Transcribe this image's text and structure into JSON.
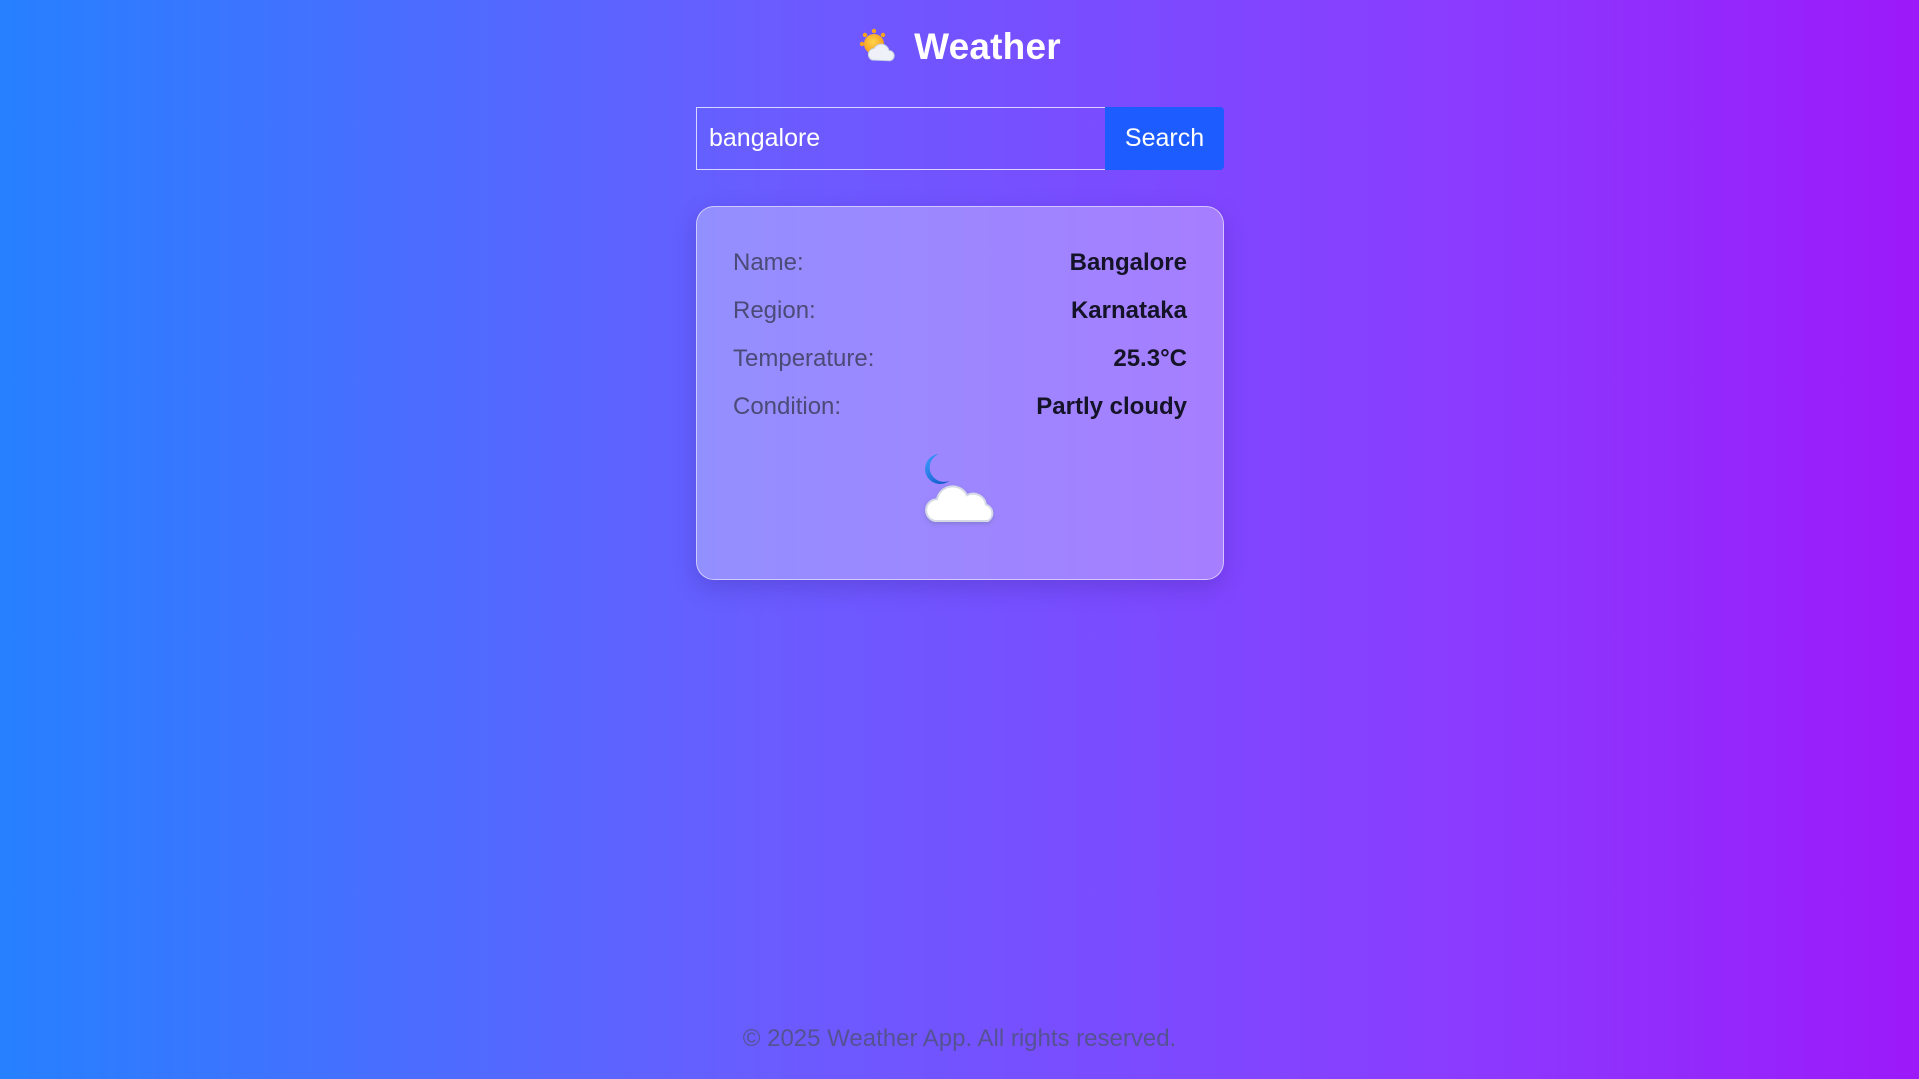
{
  "header": {
    "title": "Weather",
    "icon": "sun-behind-cloud-icon"
  },
  "search": {
    "value": "bangalore",
    "button_label": "Search"
  },
  "weather": {
    "rows": [
      {
        "label": "Name:",
        "value": "Bangalore"
      },
      {
        "label": "Region:",
        "value": "Karnataka"
      },
      {
        "label": "Temperature:",
        "value": "25.3°C"
      },
      {
        "label": "Condition:",
        "value": "Partly cloudy"
      }
    ],
    "condition_icon": "moon-cloud-icon"
  },
  "footer": {
    "text": "© 2025 Weather App. All rights reserved."
  },
  "colors": {
    "gradient_start": "#2680ff",
    "gradient_end": "#9c19fa",
    "button": "#1d5cff"
  }
}
